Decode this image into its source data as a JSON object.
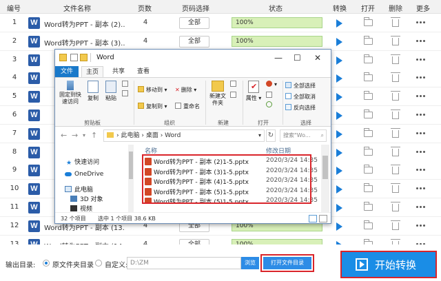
{
  "header": {
    "col_index": "编号",
    "col_filename": "文件名称",
    "col_pages": "页数",
    "col_page_select": "页码选择",
    "col_status": "状态",
    "col_convert": "转换",
    "col_open": "打开",
    "col_delete": "删除",
    "col_more": "更多"
  },
  "rows": [
    {
      "index": "1",
      "name": "Word转为PPT - 副本 (2)....",
      "pages": "4",
      "select": "全部",
      "status": "100%",
      "progress": 1.0
    },
    {
      "index": "2",
      "name": "Word转为PPT - 副本 (3)....",
      "pages": "4",
      "select": "全部",
      "status": "100%",
      "progress": 1.0
    },
    {
      "index": "3",
      "name": "",
      "pages": "",
      "select": "",
      "status": "",
      "progress": 1.0
    },
    {
      "index": "4",
      "name": "",
      "pages": "",
      "select": "",
      "status": "",
      "progress": 1.0
    },
    {
      "index": "5",
      "name": "",
      "pages": "",
      "select": "",
      "status": "",
      "progress": 1.0
    },
    {
      "index": "6",
      "name": "",
      "pages": "",
      "select": "",
      "status": "",
      "progress": 1.0
    },
    {
      "index": "7",
      "name": "",
      "pages": "",
      "select": "",
      "status": "",
      "progress": 1.0
    },
    {
      "index": "8",
      "name": "",
      "pages": "",
      "select": "",
      "status": "",
      "progress": 1.0
    },
    {
      "index": "9",
      "name": "",
      "pages": "",
      "select": "",
      "status": "",
      "progress": 1.0
    },
    {
      "index": "10",
      "name": "",
      "pages": "",
      "select": "",
      "status": "",
      "progress": 1.0
    },
    {
      "index": "11",
      "name": "",
      "pages": "",
      "select": "",
      "status": "",
      "progress": 1.0
    },
    {
      "index": "12",
      "name": "Word转为PPT - 副本 (13....",
      "pages": "4",
      "select": "全部",
      "status": "100%",
      "progress": 1.0
    },
    {
      "index": "13",
      "name": "Word转为PPT - 副本 (14....",
      "pages": "4",
      "select": "全部",
      "status": "100%",
      "progress": 1.0
    }
  ],
  "bottom": {
    "output_label": "输出目录:",
    "option_source": "原文件夹目录",
    "option_custom": "自定义:",
    "path_value": "D:\\ZM",
    "browse_label": "浏览",
    "open_folder_label": "打开文件目录",
    "start_label": "开始转换"
  },
  "explorer": {
    "title": "Word",
    "minimize": "—",
    "maximize": "☐",
    "close": "✕",
    "tabs": {
      "file": "文件",
      "home": "主页",
      "share": "共享",
      "view": "查看"
    },
    "ribbon": {
      "pin": "固定到快速访问",
      "copy": "复制",
      "paste": "粘贴",
      "clipboard_group": "剪贴板",
      "move_to": "移动到",
      "delete": "删除",
      "copy_to": "复制到",
      "rename": "重命名",
      "organize_group": "组织",
      "new_folder": "新建文件夹",
      "new_group": "新建",
      "properties": "属性",
      "open_group": "打开",
      "select_all": "全部选择",
      "select_none": "全部取消",
      "invert_selection": "反向选择",
      "select_group": "选择"
    },
    "address": {
      "pc": "此电脑",
      "desktop": "桌面",
      "folder": "Word",
      "search_placeholder": "搜索\"Wo..."
    },
    "nav": {
      "quick_access": "快速访问",
      "onedrive": "OneDrive",
      "this_pc": "此电脑",
      "objects_3d": "3D 对象",
      "videos": "视频"
    },
    "columns": {
      "name": "名称",
      "modified": "修改日期"
    },
    "files": [
      {
        "name": "Word转为PPT - 副本 (2)1-5.pptx",
        "date": "2020/3/24 14:35"
      },
      {
        "name": "Word转为PPT - 副本 (3)1-5.pptx",
        "date": "2020/3/24 14:35"
      },
      {
        "name": "Word转为PPT - 副本 (4)1-5.pptx",
        "date": "2020/3/24 14:35"
      },
      {
        "name": "Word转为PPT - 副本 (5)1-5.pptx",
        "date": "2020/3/24 14:35"
      },
      {
        "name": "Word转为PPT - 副本 (5)1-5.pptx",
        "date": "2020/3/24 14:35"
      }
    ],
    "status": {
      "count": "32 个项目",
      "selected": "选中 1 个项目  38.6 KB"
    }
  },
  "colors": {
    "accent": "#1a8de6",
    "word_icon": "#2b5ca8",
    "progress_fill": "#d8f0b8",
    "highlight": "#d9242a"
  }
}
